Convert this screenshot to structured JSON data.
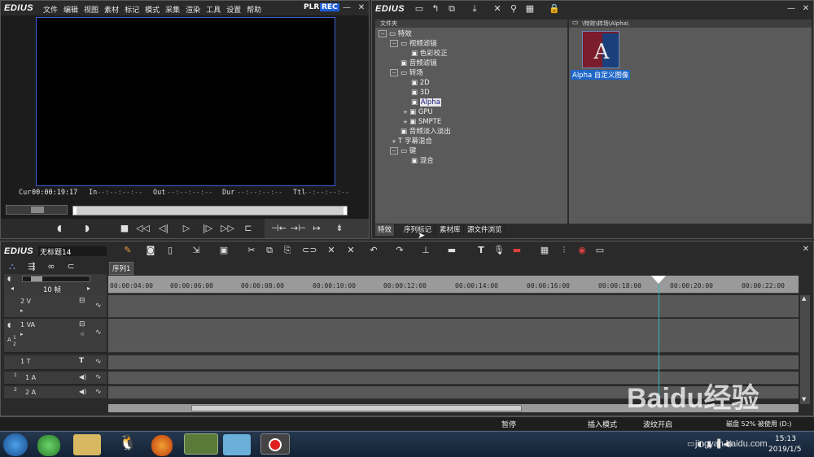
{
  "player": {
    "logo": "EDIUS",
    "menu": [
      "文件",
      "编辑",
      "视图",
      "素材",
      "标记",
      "模式",
      "采集",
      "渲染",
      "工具",
      "设置",
      "帮助"
    ],
    "plr": "PLR",
    "rec": "REC",
    "timecodes": {
      "cur_label": "Cur",
      "cur_value": "00:00:19:17",
      "in_label": "In",
      "in_value": "--:--:--:--",
      "out_label": "Out",
      "out_value": "--:--:--:--",
      "dur_label": "Dur",
      "dur_value": "--:--:--:--",
      "ttl_label": "Ttl",
      "ttl_value": "--:--:--:--"
    }
  },
  "bin": {
    "logo": "EDIUS",
    "folder_header": "文件夹",
    "path": "\\特效\\转场\\Alpha\\",
    "tree": [
      {
        "label": "特效",
        "level": 0,
        "expanded": true
      },
      {
        "label": "视频滤镜",
        "level": 1,
        "expanded": true
      },
      {
        "label": "色彩校正",
        "level": 2
      },
      {
        "label": "音频滤镜",
        "level": 1
      },
      {
        "label": "转场",
        "level": 1,
        "expanded": true
      },
      {
        "label": "2D",
        "level": 2
      },
      {
        "label": "3D",
        "level": 2
      },
      {
        "label": "Alpha",
        "level": 2,
        "selected": true
      },
      {
        "label": "GPU",
        "level": 2
      },
      {
        "label": "SMPTE",
        "level": 2
      },
      {
        "label": "音频淡入淡出",
        "level": 1
      },
      {
        "label": "字幕混合",
        "level": 1
      },
      {
        "label": "键",
        "level": 1,
        "expanded": true
      },
      {
        "label": "混合",
        "level": 2
      }
    ],
    "item_label": "Alpha 自定义图像",
    "tabs": [
      "特效",
      "序列标记",
      "素材库",
      "源文件浏览"
    ]
  },
  "timeline": {
    "logo": "EDIUS",
    "project_name": "无标题14",
    "sequence_tab": "序列1",
    "scale": "10 帧",
    "ruler": [
      "00:00:04:00",
      "00:00:06:00",
      "00:00:08:00",
      "00:00:10:00",
      "00:00:12:00",
      "00:00:14:00",
      "00:00:16:00",
      "00:00:18:00",
      "00:00:20:00",
      "00:00:22:00"
    ],
    "tracks": [
      {
        "name": "2 V"
      },
      {
        "name": "1 VA"
      },
      {
        "name": "1 T"
      },
      {
        "name": "1 A"
      },
      {
        "name": "2 A"
      }
    ],
    "track_side_labels": {
      "va_a": "A",
      "va_1": "1",
      "va_2": "2",
      "a_1": "1",
      "a_2": "2"
    }
  },
  "status": {
    "pause": "暂停",
    "insert_mode": "插入模式",
    "ripple": "波纹开启",
    "disk": "磁盘 52% 被使用 (D:)"
  },
  "taskbar": {
    "time": "15:13",
    "date": "2019/1/5"
  },
  "watermark": {
    "brand": "Baidu经验",
    "url": "jingyan.baidu.com"
  },
  "colors": {
    "rec": "#1e5ed8",
    "monitor_border": "#3a62d6",
    "selection": "#1e66c8",
    "cursor_line": "#2bb6b6"
  }
}
